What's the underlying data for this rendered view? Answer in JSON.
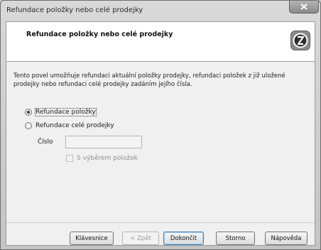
{
  "window": {
    "title": "Refundace položky nebo celé prodejky",
    "close_icon": "close-icon"
  },
  "header": {
    "title": "Refundace položky nebo celé prodejky",
    "logo_icon": "app-logo-icon"
  },
  "description": "Tento povel umožňuje refundaci aktuální položky prodejky, refundaci položek z již uložené prodejky nebo refundaci celé prodejky zadáním jejího čísla.",
  "options": {
    "item_refund_label": "Refundace položky",
    "item_refund_selected": true,
    "full_refund_label": "Refundace celé prodejky",
    "full_refund_selected": false,
    "number_label": "Číslo",
    "number_value": "",
    "select_items_label": "S výběrem položek",
    "select_items_checked": false
  },
  "buttons": {
    "keyboard": "Klávesnice",
    "back": "< Zpět",
    "finish": "Dokončit",
    "cancel": "Storno",
    "help": "Nápověda"
  }
}
